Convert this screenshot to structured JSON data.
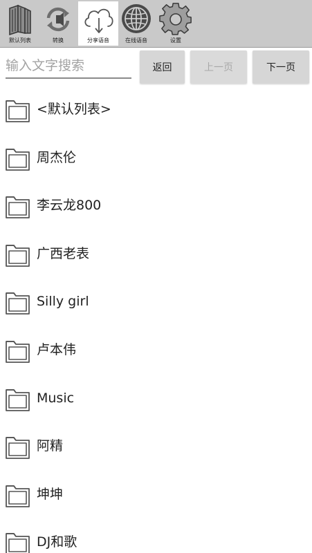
{
  "toolbar": {
    "items": [
      {
        "label": "默认列表",
        "icon": "books-icon",
        "active": false
      },
      {
        "label": "转换",
        "icon": "convert-icon",
        "active": false
      },
      {
        "label": "分享语音",
        "icon": "cloud-download-icon",
        "active": true
      },
      {
        "label": "在线语音",
        "icon": "globe-icon",
        "active": false
      },
      {
        "label": "设置",
        "icon": "gear-icon",
        "active": false
      }
    ]
  },
  "search": {
    "placeholder": "输入文字搜索",
    "value": ""
  },
  "nav": {
    "back_label": "返回",
    "prev_label": "上一页",
    "next_label": "下一页",
    "prev_enabled": false
  },
  "folders": [
    {
      "name": "<默认列表>"
    },
    {
      "name": "周杰伦"
    },
    {
      "name": "李云龙800"
    },
    {
      "name": "广西老表"
    },
    {
      "name": "Silly girl"
    },
    {
      "name": "卢本伟"
    },
    {
      "name": "Music"
    },
    {
      "name": "阿精"
    },
    {
      "name": "坤坤"
    },
    {
      "name": "DJ和歌"
    }
  ],
  "colors": {
    "toolbar_bg": "#c9c9c9",
    "active_tab_bg": "#ffffff",
    "button_bg": "#d6d6d6",
    "disabled_text": "#a8a8a8",
    "icon_stroke": "#6e6e6e"
  }
}
